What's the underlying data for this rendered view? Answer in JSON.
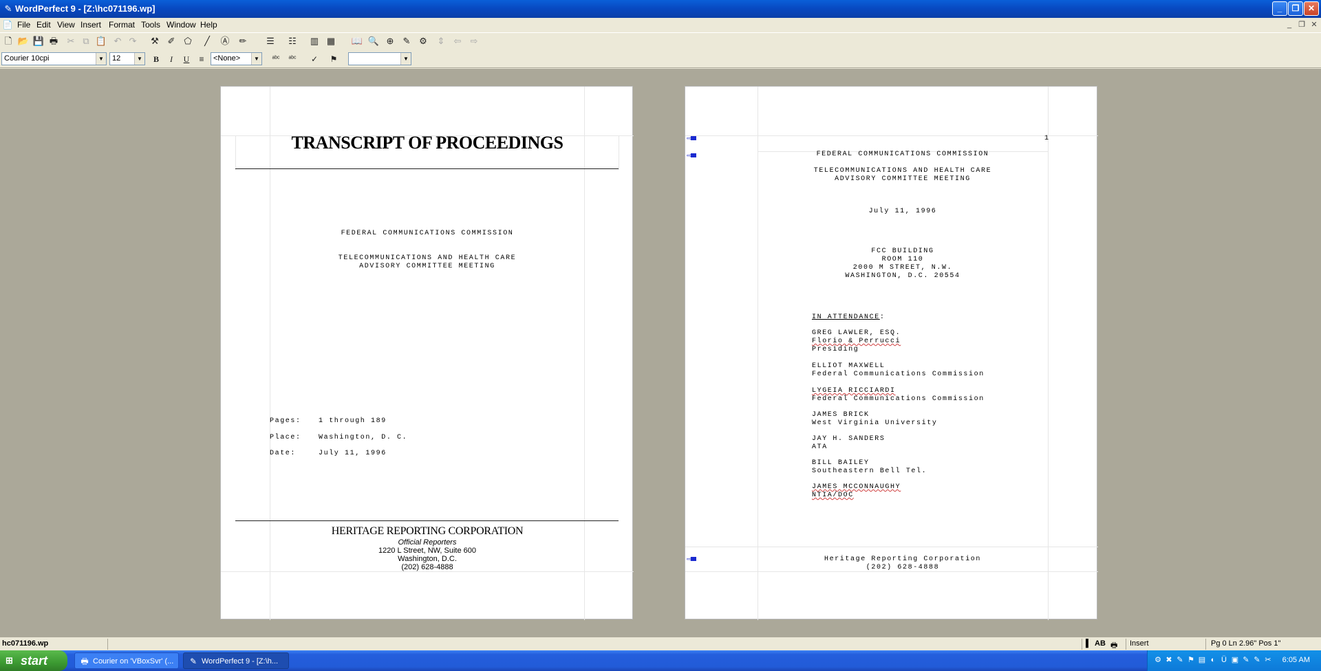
{
  "window": {
    "title": "WordPerfect 9 - [Z:\\hc071196.wp]",
    "minimize": "_",
    "restore": "❐",
    "close": "✕"
  },
  "menu": [
    "File",
    "Edit",
    "View",
    "Insert",
    "Format",
    "Tools",
    "Window",
    "Help"
  ],
  "property_bar": {
    "font_face": "Courier 10cpi",
    "font_size": "12",
    "style": "<None>",
    "bold": "B",
    "italic": "I",
    "underline": "U"
  },
  "page1": {
    "header_title": "TRANSCRIPT OF PROCEEDINGS",
    "commission": "FEDERAL COMMUNICATIONS COMMISSION",
    "meeting_line1": "TELECOMMUNICATIONS AND HEALTH CARE",
    "meeting_line2": "ADVISORY COMMITTEE MEETING",
    "details": [
      {
        "label": "Pages:",
        "value": "1 through 189"
      },
      {
        "label": "Place:",
        "value": "Washington, D. C."
      },
      {
        "label": "Date:",
        "value": "July 11, 1996"
      }
    ],
    "footer": {
      "company": "HERITAGE REPORTING CORPORATION",
      "tagline": "Official Reporters",
      "address": "1220 L Street, NW, Suite 600",
      "city": "Washington, D.C.",
      "phone": "(202) 628-4888"
    }
  },
  "page2": {
    "page_number": "1",
    "commission": "FEDERAL COMMUNICATIONS COMMISSION",
    "meeting_line1": "TELECOMMUNICATIONS AND HEALTH CARE",
    "meeting_line2": "ADVISORY COMMITTEE MEETING",
    "date": "July 11, 1996",
    "location": [
      "FCC BUILDING",
      "ROOM 110",
      "2000 M STREET, N.W.",
      "WASHINGTON, D.C.  20554"
    ],
    "attendance_heading": "IN ATTENDANCE",
    "attendance_colon": ":",
    "attendees": [
      {
        "name": "GREG LAWLER, ESQ.",
        "lines": [
          "Florio & Perrucci",
          "Presiding"
        ]
      },
      {
        "name": "ELLIOT MAXWELL",
        "lines": [
          "Federal Communications Commission"
        ]
      },
      {
        "name": "LYGEIA RICCIARDI",
        "lines": [
          "Federal Communications Commission"
        ]
      },
      {
        "name": "JAMES BRICK",
        "lines": [
          "West Virginia University"
        ]
      },
      {
        "name": "JAY H. SANDERS",
        "lines": [
          "ATA"
        ]
      },
      {
        "name": "BILL BAILEY",
        "lines": [
          "Southeastern Bell Tel."
        ]
      },
      {
        "name": "JAMES MCCONNAUGHY",
        "lines": [
          "NTIA/DOC"
        ]
      }
    ],
    "footer_line1": "Heritage Reporting Corporation",
    "footer_line2": "(202) 628-4888"
  },
  "status": {
    "filename": "hc071196.wp",
    "mode": "Insert",
    "position": "Pg 0 Ln 2.96\" Pos 1\"",
    "ab": "AB"
  },
  "taskbar": {
    "start": "start",
    "tasks": [
      "Courier on 'VBoxSvr' (...",
      "WordPerfect 9 - [Z:\\h..."
    ],
    "clock": "6:05 AM"
  },
  "icons": {
    "toolbar": [
      "new-document-icon",
      "open-icon",
      "save-icon",
      "print-icon",
      "cut-icon",
      "copy-icon",
      "paste-icon",
      "undo-icon",
      "redo-icon",
      "qucikformat-icon",
      "highlight-icon",
      "shapes-icon",
      "text-box-icon",
      "line-icon",
      "pen-icon",
      "numbering-icon",
      "bullets-icon",
      "columns-icon",
      "table-icon",
      "find-icon",
      "zoom-icon",
      "navigate-icon",
      "marker-icon",
      "hyperlink-icon",
      "prev-icon",
      "next-icon"
    ]
  }
}
